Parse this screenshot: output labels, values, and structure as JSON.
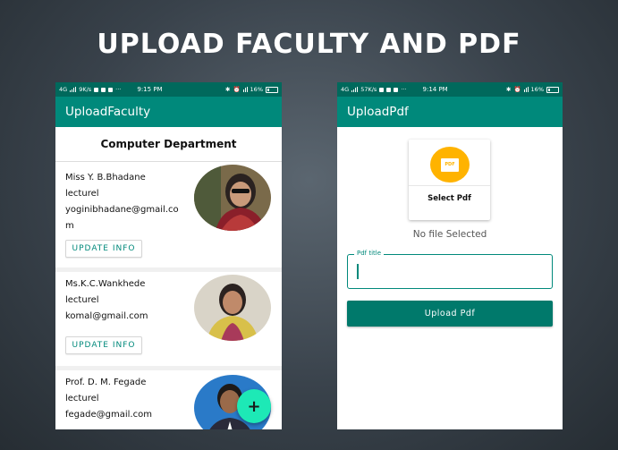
{
  "slide": {
    "title": "UPLOAD FACULTY AND PDF"
  },
  "left_phone": {
    "status": {
      "network": "4G",
      "speed": "9K/s",
      "time": "9:15 PM",
      "battery": "16%"
    },
    "appbar_title": "UploadFaculty",
    "department": "Computer Department",
    "faculty": [
      {
        "name": "Miss Y. B.Bhadane",
        "role": "lecturel",
        "email": "yoginibhadane@gmail.com",
        "button": "UPDATE INFO"
      },
      {
        "name": "Ms.K.C.Wankhede",
        "role": "lecturel",
        "email": "komal@gmail.com",
        "button": "UPDATE INFO"
      },
      {
        "name": "Prof. D. M. Fegade",
        "role": "lecturel",
        "email": "fegade@gmail.com"
      }
    ],
    "fab_label": "+"
  },
  "right_phone": {
    "status": {
      "network": "4G",
      "speed": "57K/s",
      "time": "9:14 PM",
      "battery": "16%"
    },
    "appbar_title": "UploadPdf",
    "pdf_icon_text": "PDF",
    "select_pdf_label": "Select Pdf",
    "file_status": "No file Selected",
    "pdf_title_label": "Pdf title",
    "pdf_title_value": "",
    "upload_button": "Upload Pdf"
  },
  "colors": {
    "primary": "#00897b",
    "primary_dark": "#00695c",
    "fab": "#1de9b6",
    "pdf_icon": "#ffb300"
  }
}
